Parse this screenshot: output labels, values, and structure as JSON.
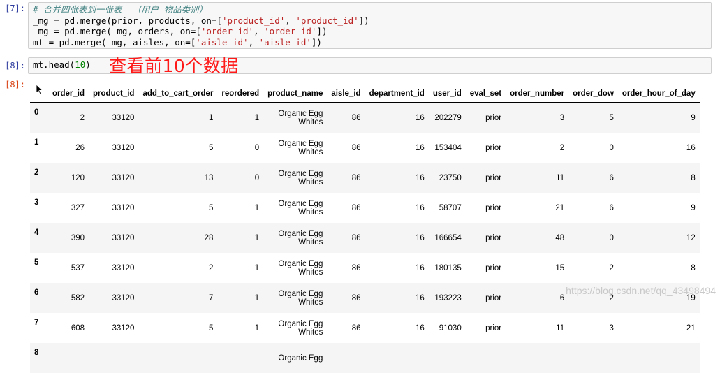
{
  "cells": {
    "cell7": {
      "prompt": "[7]:",
      "lines": [
        [
          {
            "t": "# 合并四张表到一张表  （用户-物品类别）",
            "c": "cm"
          }
        ],
        [
          {
            "t": "_mg = pd.merge(prior, products, on=[",
            "c": "kw"
          },
          {
            "t": "'product_id'",
            "c": "st"
          },
          {
            "t": ", ",
            "c": "kw"
          },
          {
            "t": "'product_id'",
            "c": "st"
          },
          {
            "t": "])",
            "c": "kw"
          }
        ],
        [
          {
            "t": "_mg = pd.merge(_mg, orders, on=[",
            "c": "kw"
          },
          {
            "t": "'order_id'",
            "c": "st"
          },
          {
            "t": ", ",
            "c": "kw"
          },
          {
            "t": "'order_id'",
            "c": "st"
          },
          {
            "t": "])",
            "c": "kw"
          }
        ],
        [
          {
            "t": "mt = pd.merge(_mg, aisles, on=[",
            "c": "kw"
          },
          {
            "t": "'aisle_id'",
            "c": "st"
          },
          {
            "t": ", ",
            "c": "kw"
          },
          {
            "t": "'aisle_id'",
            "c": "st"
          },
          {
            "t": "])",
            "c": "kw"
          }
        ]
      ]
    },
    "cell8": {
      "prompt": "[8]:",
      "code_parts": [
        {
          "t": "mt.head(",
          "c": "kw"
        },
        {
          "t": "10",
          "c": "nm"
        },
        {
          "t": ")",
          "c": "kw"
        }
      ],
      "annotation": "查看前10个数据",
      "out_prompt": "[8]:"
    }
  },
  "table": {
    "columns": [
      "",
      "order_id",
      "product_id",
      "add_to_cart_order",
      "reordered",
      "product_name",
      "aisle_id",
      "department_id",
      "user_id",
      "eval_set",
      "order_number",
      "order_dow",
      "order_hour_of_day"
    ],
    "rows": [
      [
        "0",
        "2",
        "33120",
        "1",
        "1",
        "Organic Egg Whites",
        "86",
        "16",
        "202279",
        "prior",
        "3",
        "5",
        "9"
      ],
      [
        "1",
        "26",
        "33120",
        "5",
        "0",
        "Organic Egg Whites",
        "86",
        "16",
        "153404",
        "prior",
        "2",
        "0",
        "16"
      ],
      [
        "2",
        "120",
        "33120",
        "13",
        "0",
        "Organic Egg Whites",
        "86",
        "16",
        "23750",
        "prior",
        "11",
        "6",
        "8"
      ],
      [
        "3",
        "327",
        "33120",
        "5",
        "1",
        "Organic Egg Whites",
        "86",
        "16",
        "58707",
        "prior",
        "21",
        "6",
        "9"
      ],
      [
        "4",
        "390",
        "33120",
        "28",
        "1",
        "Organic Egg Whites",
        "86",
        "16",
        "166654",
        "prior",
        "48",
        "0",
        "12"
      ],
      [
        "5",
        "537",
        "33120",
        "2",
        "1",
        "Organic Egg Whites",
        "86",
        "16",
        "180135",
        "prior",
        "15",
        "2",
        "8"
      ],
      [
        "6",
        "582",
        "33120",
        "7",
        "1",
        "Organic Egg Whites",
        "86",
        "16",
        "193223",
        "prior",
        "6",
        "2",
        "19"
      ],
      [
        "7",
        "608",
        "33120",
        "5",
        "1",
        "Organic Egg Whites",
        "86",
        "16",
        "91030",
        "prior",
        "11",
        "3",
        "21"
      ],
      [
        "8",
        "",
        "",
        "",
        "",
        "Organic Egg",
        "",
        "",
        "",
        "",
        "",
        "",
        ""
      ]
    ]
  },
  "watermark": "https://blog.csdn.net/qq_43498494",
  "colors": {
    "prompt_in": "#303f9f",
    "prompt_out": "#d84315",
    "string": "#ba2121",
    "comment": "#408080",
    "number": "#008000",
    "annotation": "#ff1a1a"
  }
}
